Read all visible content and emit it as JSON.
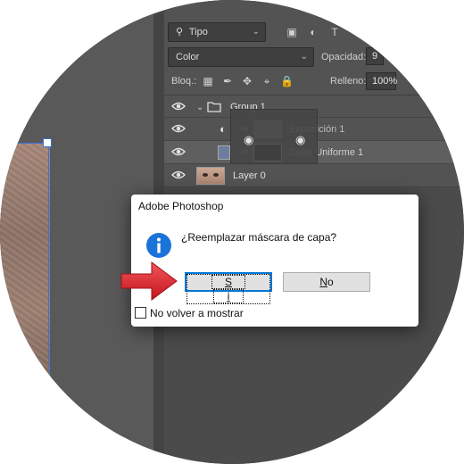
{
  "options_bar": {
    "filter_kind": "Tipo",
    "blend_mode": "Color",
    "opacity_label": "Opacidad:",
    "opacity_value": "9",
    "lock_label": "Bloq.:",
    "fill_label": "Relleno:",
    "fill_value": "100%"
  },
  "layers": [
    {
      "name": "Group 1",
      "type": "group"
    },
    {
      "name": "Exposición 1",
      "type": "adjustment"
    },
    {
      "name": "Color Uniforme 1",
      "type": "fill",
      "selected": true
    },
    {
      "name": "Layer 0",
      "type": "image"
    }
  ],
  "dialog": {
    "title": "Adobe Photoshop",
    "message": "¿Reemplazar máscara de capa?",
    "yes_label_pre": "S",
    "yes_label_accel": "í",
    "no_label_accel": "N",
    "no_label_post": "o",
    "checkbox_label": "No volver a mostrar"
  },
  "colors": {
    "accent": "#0078d7",
    "arrow": "#e8323a",
    "info_icon": "#1a73d9",
    "fill_swatch": "#6b7ea0"
  },
  "icons": [
    "search-icon",
    "eye-icon",
    "folder-icon",
    "lock-icon",
    "move-icon",
    "brush-icon",
    "info-icon",
    "arrow-icon"
  ]
}
